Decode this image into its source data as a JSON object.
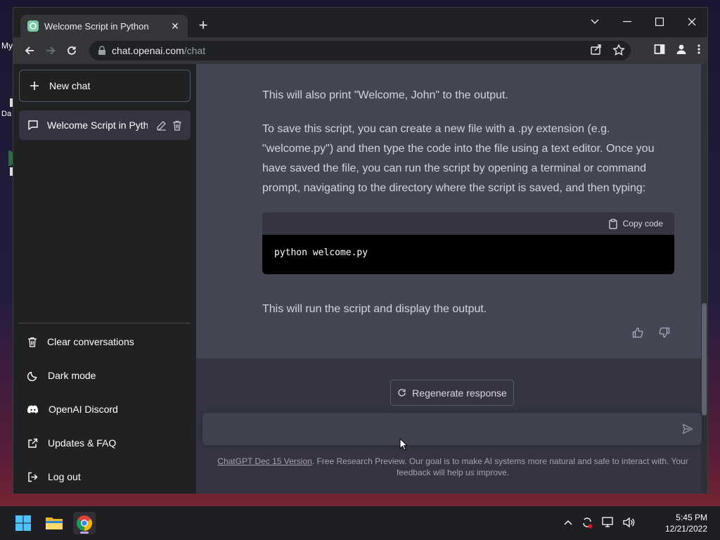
{
  "desktop": {
    "label_1": "My",
    "label_2": "Da"
  },
  "browser": {
    "tab_title": "Welcome Script in Python",
    "url_host": "chat.openai.com",
    "url_path": "/chat"
  },
  "sidebar": {
    "new_chat": "New chat",
    "conversation_title": "Welcome Script in Pyth",
    "links": [
      {
        "label": "Clear conversations",
        "icon": "trash-icon"
      },
      {
        "label": "Dark mode",
        "icon": "moon-icon"
      },
      {
        "label": "OpenAI Discord",
        "icon": "discord-icon"
      },
      {
        "label": "Updates & FAQ",
        "icon": "external-link-icon"
      },
      {
        "label": "Log out",
        "icon": "logout-icon"
      }
    ]
  },
  "chat": {
    "p1": "This will also print \"Welcome, John\" to the output.",
    "p2": "To save this script, you can create a new file with a .py extension (e.g. \"welcome.py\") and then type the code into the file using a text editor. Once you have saved the file, you can run the script by opening a terminal or command prompt, navigating to the directory where the script is saved, and then typing:",
    "copy_code": "Copy code",
    "code": "python welcome.py",
    "p3": "This will run the script and display the output.",
    "regenerate": "Regenerate response",
    "input_value": "",
    "footer_link": "ChatGPT Dec 15 Version",
    "footer_text": ". Free Research Preview. Our goal is to make AI systems more natural and safe to interact with. Your feedback will help us improve."
  },
  "taskbar": {
    "time": "5:45 PM",
    "date": "12/21/2022"
  },
  "colors": {
    "sidebar_bg": "#202123",
    "chat_bg": "#343541",
    "answer_bg": "#444654",
    "input_bg": "#40414f"
  }
}
